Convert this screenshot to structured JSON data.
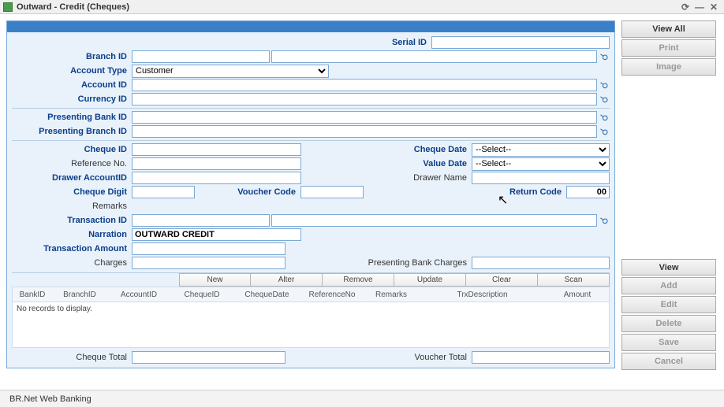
{
  "window": {
    "title": "Outward - Credit (Cheques)"
  },
  "side1": {
    "viewall": "View All",
    "print": "Print",
    "image": "Image"
  },
  "side2": {
    "view": "View",
    "add": "Add",
    "edit": "Edit",
    "delete": "Delete",
    "save": "Save",
    "cancel": "Cancel"
  },
  "labels": {
    "serial_id": "Serial ID",
    "branch_id": "Branch ID",
    "account_type": "Account Type",
    "account_id": "Account ID",
    "currency_id": "Currency ID",
    "presenting_bank_id": "Presenting Bank ID",
    "presenting_branch_id": "Presenting Branch ID",
    "cheque_id": "Cheque ID",
    "cheque_date": "Cheque Date",
    "reference_no": "Reference No.",
    "value_date": "Value Date",
    "drawer_accountid": "Drawer AccountID",
    "drawer_name": "Drawer Name",
    "cheque_digit": "Cheque Digit",
    "voucher_code": "Voucher Code",
    "return_code": "Return Code",
    "remarks": "Remarks",
    "transaction_id": "Transaction ID",
    "narration": "Narration",
    "transaction_amount": "Transaction Amount",
    "charges": "Charges",
    "presenting_bank_charges": "Presenting Bank Charges",
    "cheque_total": "Cheque Total",
    "voucher_total": "Voucher Total"
  },
  "values": {
    "account_type": "Customer",
    "narration": "OUTWARD CREDIT",
    "return_code": "00",
    "cheque_date_sel": "--Select--",
    "value_date_sel": "--Select--"
  },
  "toolbar": {
    "new": "New",
    "alter": "Alter",
    "remove": "Remove",
    "update": "Update",
    "clear": "Clear",
    "scan": "Scan"
  },
  "grid": {
    "cols": {
      "bankid": "BankID",
      "branchid": "BranchID",
      "accountid": "AccountID",
      "chequeid": "ChequeID",
      "chequedate": "ChequeDate",
      "referenceno": "ReferenceNo",
      "remarks": "Remarks",
      "trxdescription": "TrxDescription",
      "amount": "Amount"
    },
    "empty": "No records to display."
  },
  "status": {
    "text": "BR.Net Web Banking"
  }
}
